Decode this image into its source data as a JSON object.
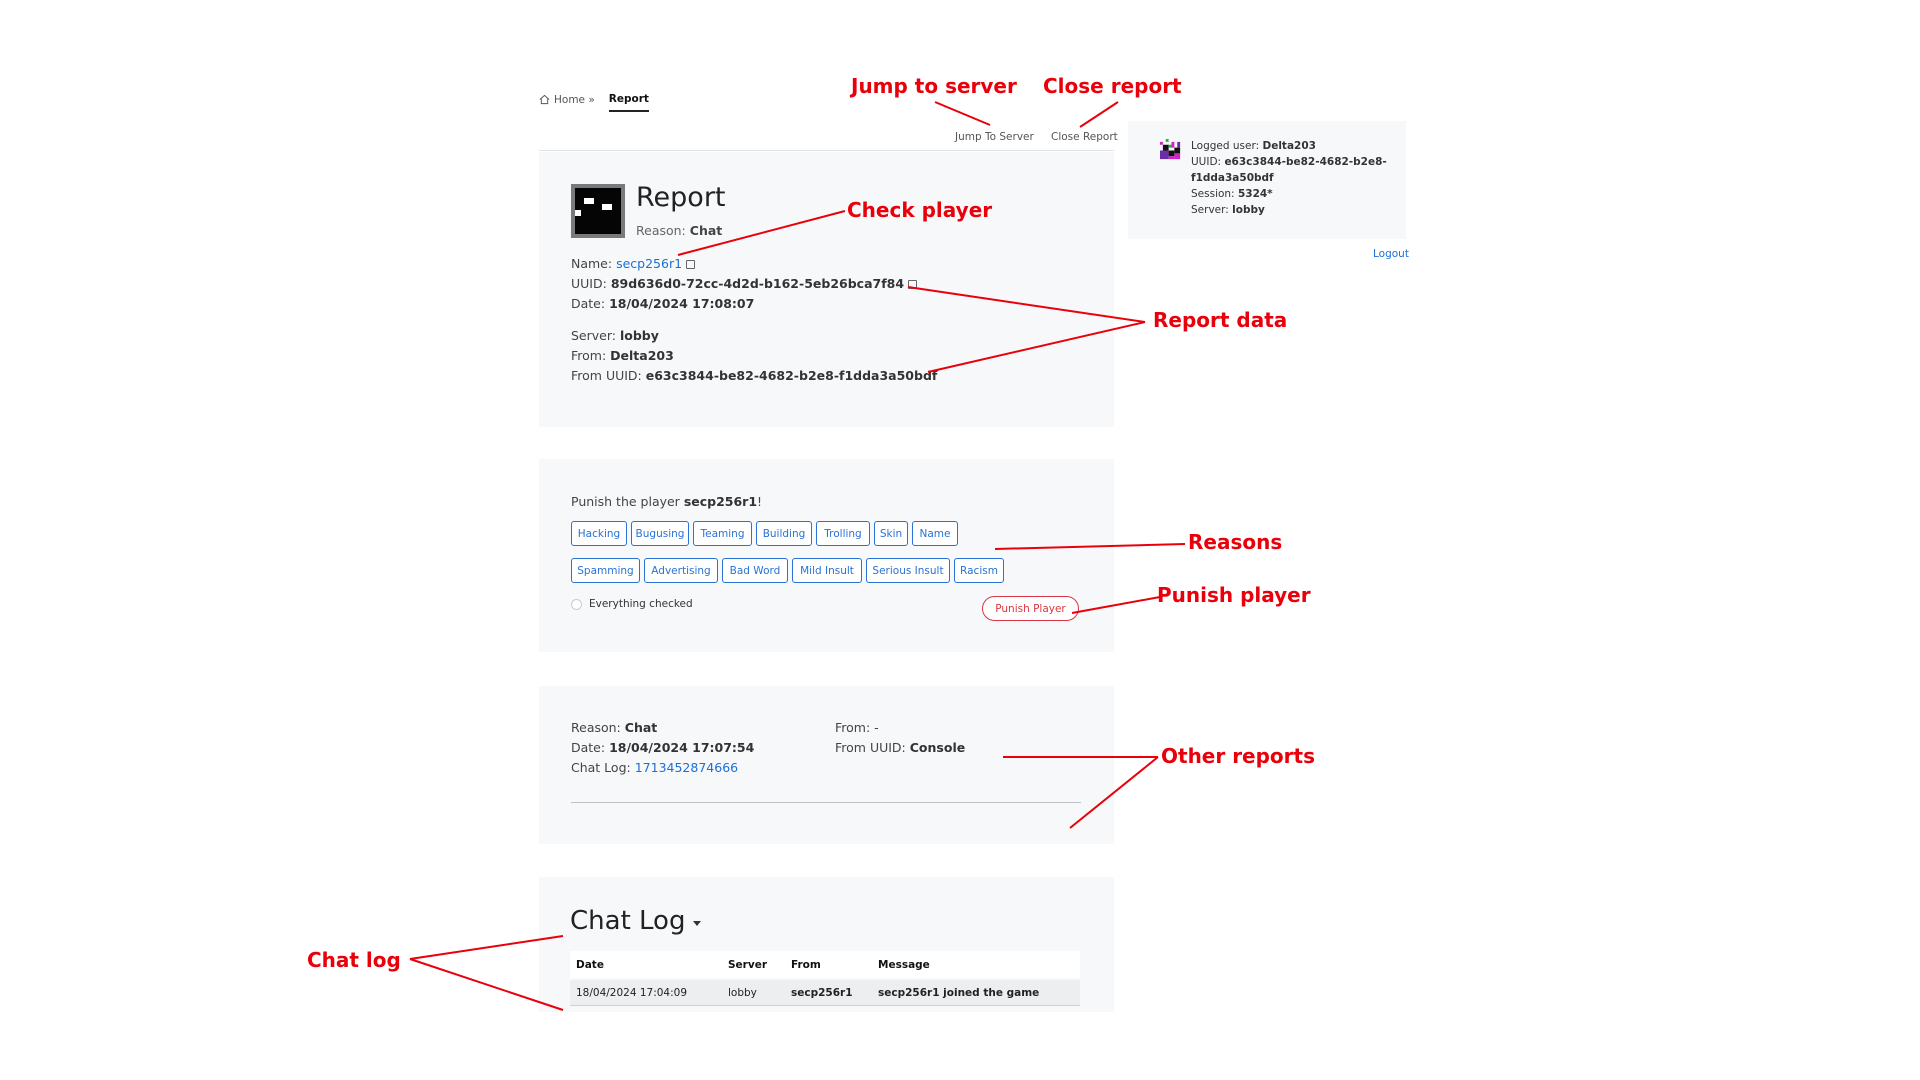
{
  "breadcrumb": {
    "home": "Home »",
    "current": "Report"
  },
  "toolbar": {
    "jump_label": "Jump To Server",
    "close_label": "Close Report"
  },
  "report": {
    "title": "Report",
    "reason_label": "Reason:",
    "reason_value": "Chat",
    "name_label": "Name:",
    "name_value": "secp256r1",
    "uuid_label": "UUID:",
    "uuid_value": "89d636d0-72cc-4d2d-b162-5eb26bca7f84",
    "date_label": "Date:",
    "date_value": "18/04/2024 17:08:07",
    "server_label": "Server:",
    "server_value": "lobby",
    "from_label": "From:",
    "from_value": "Delta203",
    "from_uuid_label": "From UUID:",
    "from_uuid_value": "e63c3844-be82-4682-b2e8-f1dda3a50bdf"
  },
  "punish": {
    "prefix": "Punish the player",
    "player": "secp256r1",
    "suffix": "!",
    "reasons_row1": [
      "Hacking",
      "Bugusing",
      "Teaming",
      "Building",
      "Trolling",
      "Skin",
      "Name"
    ],
    "reasons_row2": [
      "Spamming",
      "Advertising",
      "Bad Word",
      "Mild Insult",
      "Serious Insult",
      "Racism"
    ],
    "checkbox_label": "Everything checked",
    "button_label": "Punish Player"
  },
  "other_report": {
    "reason_label": "Reason:",
    "reason_value": "Chat",
    "date_label": "Date:",
    "date_value": "18/04/2024 17:07:54",
    "chatlog_label": "Chat Log:",
    "chatlog_value": "1713452874666",
    "from_label": "From:",
    "from_value": "-",
    "from_uuid_label": "From UUID:",
    "from_uuid_value": "Console"
  },
  "chat_log": {
    "title": "Chat Log",
    "headers": [
      "Date",
      "Server",
      "From",
      "Message"
    ],
    "rows": [
      [
        "18/04/2024 17:04:09",
        "lobby",
        "secp256r1",
        "secp256r1 joined the game"
      ]
    ]
  },
  "user_panel": {
    "logged_label": "Logged user:",
    "logged_value": "Delta203",
    "uuid_label": "UUID:",
    "uuid_value_1": "e63c3844-be82-4682-b2e8-",
    "uuid_value_2": "f1dda3a50bdf",
    "session_label": "Session:",
    "session_value": "5324*",
    "server_label": "Server:",
    "server_value": "lobby",
    "logout_label": "Logout"
  },
  "annotations": {
    "jump_to_server": "Jump to server",
    "close_report": "Close report",
    "check_player": "Check player",
    "report_data": "Report data",
    "reasons": "Reasons",
    "punish_player": "Punish player",
    "other_reports": "Other reports",
    "chat_log": "Chat log"
  },
  "colors": {
    "annotation": "#e8000b",
    "link": "#1c6fd6",
    "primary_outline": "#2a72d4",
    "danger": "#dc3545",
    "card_bg": "#f7f8f9"
  }
}
